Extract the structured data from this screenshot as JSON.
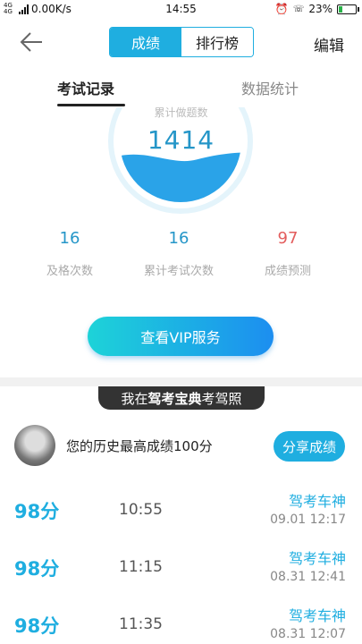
{
  "status_bar": {
    "network": "4G 4G",
    "speed": "0.00K/s",
    "time": "14:55",
    "battery": "23%"
  },
  "header": {
    "tabs": [
      "成绩",
      "排行榜"
    ],
    "edit_label": "编辑"
  },
  "subtabs": {
    "record": "考试记录",
    "stats": "数据统计"
  },
  "gauge": {
    "label": "累计做题数",
    "value": "1414",
    "fill_fraction": 0.35
  },
  "stats": [
    {
      "value": "16",
      "label": "及格次数",
      "color": "#2596c8"
    },
    {
      "value": "16",
      "label": "累计考试次数",
      "color": "#2596c8"
    },
    {
      "value": "97",
      "label": "成绩预测",
      "color": "#e35d5d"
    }
  ],
  "vip_button": "查看VIP服务",
  "banner": {
    "prefix": "我在",
    "brand": "驾考宝典",
    "suffix": "考驾照"
  },
  "best": {
    "text": "您的历史最高成绩100分",
    "share": "分享成绩"
  },
  "records": [
    {
      "score": "98分",
      "time": "10:55",
      "title": "驾考车神",
      "date": "09.01  12:17"
    },
    {
      "score": "98分",
      "time": "11:15",
      "title": "驾考车神",
      "date": "08.31  12:41"
    },
    {
      "score": "98分",
      "time": "11:35",
      "title": "驾考车神",
      "date": "08.31  12:07"
    }
  ],
  "colors": {
    "accent": "#1faee0",
    "predict": "#e35d5d"
  }
}
